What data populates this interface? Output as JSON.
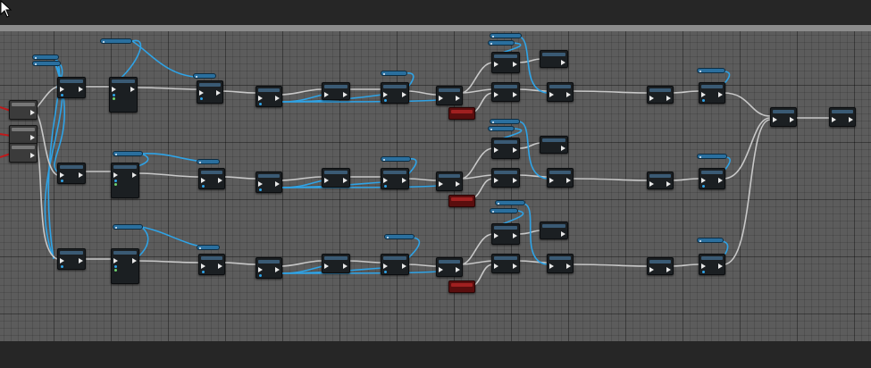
{
  "colors": {
    "wire_exec": "#c8c8c8",
    "wire_data": "#2fa3e6",
    "wire_event": "#c0191b",
    "canvas_bg": "#5c5c5c",
    "node_body": "#1b1f22",
    "var_node": "#2a6f9e"
  },
  "cursor": {
    "icon": "mouse-pointer-icon"
  }
}
